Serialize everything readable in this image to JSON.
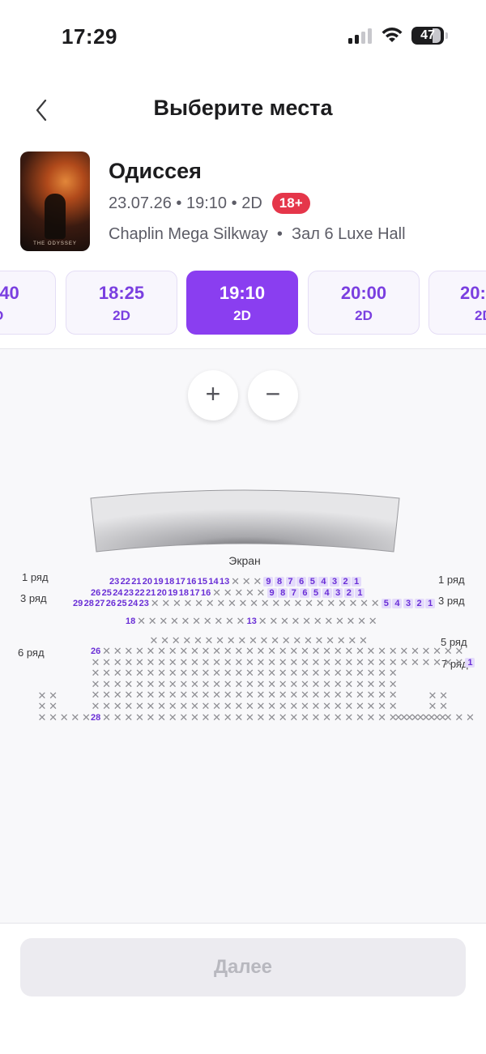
{
  "status_bar": {
    "time": "17:29",
    "battery": "47"
  },
  "header": {
    "title": "Выберите места"
  },
  "movie": {
    "title": "Одиссея",
    "poster_caption": "THE ODYSSEY",
    "date": "23.07.26",
    "time": "19:10",
    "format": "2D",
    "separator": "•",
    "age_rating": "18+",
    "cinema": "Chaplin Mega Silkway",
    "hall": "Зал 6 Luxe Hall"
  },
  "sessions": [
    {
      "time": ":40",
      "format": "D",
      "active": false
    },
    {
      "time": "18:25",
      "format": "2D",
      "active": false
    },
    {
      "time": "19:10",
      "format": "2D",
      "active": true
    },
    {
      "time": "20:00",
      "format": "2D",
      "active": false
    },
    {
      "time": "20:",
      "format": "2D",
      "active": false
    }
  ],
  "zoom": {
    "plus": "+",
    "minus": "−"
  },
  "screen_label": "Экран",
  "row_labels": {
    "row1_left": "1 ряд",
    "row3_left": "3 ряд",
    "row6_left": "6 ряд",
    "row1_right": "1 ряд",
    "row3_right": "3 ряд",
    "row5_right": "5 ряд",
    "row7_right": "7 ряд"
  },
  "seat_rows": [
    {
      "row": "1",
      "left_seats": [
        "23",
        "22",
        "21",
        "20",
        "19",
        "18",
        "17",
        "16",
        "15",
        "14",
        "13"
      ],
      "taken_count": 3,
      "right_seats": [
        "9",
        "8",
        "7",
        "6",
        "5",
        "4",
        "3",
        "2",
        "1"
      ]
    },
    {
      "row": "2",
      "left_seats": [
        "26",
        "25",
        "24",
        "23",
        "22",
        "21",
        "20",
        "19",
        "18",
        "17",
        "16"
      ],
      "taken_count": 5,
      "right_seats": [
        "9",
        "8",
        "7",
        "6",
        "5",
        "4",
        "3",
        "2",
        "1"
      ]
    },
    {
      "row": "3",
      "left_seats": [
        "29",
        "28",
        "27",
        "26",
        "25",
        "24",
        "23"
      ],
      "taken_count": 21,
      "right_seats": [
        "5",
        "4",
        "3",
        "2",
        "1"
      ]
    },
    {
      "row": "4",
      "left_seats": [
        "18"
      ],
      "taken_count": 21,
      "free_middle": "13",
      "right_seats": []
    },
    {
      "row": "5",
      "left_seats": [],
      "taken_count": 20,
      "right_seats": []
    },
    {
      "row": "6",
      "left_seats": [
        "26"
      ],
      "taken_count": 33,
      "right_seats": []
    },
    {
      "row": "7",
      "left_seats": [],
      "taken_count": 34,
      "right_seats": [
        "1"
      ]
    },
    {
      "row": "9",
      "left_seats": [
        "28"
      ],
      "taken_count": 34,
      "right_seats": []
    }
  ],
  "footer": {
    "next_label": "Далее"
  },
  "colors": {
    "accent": "#8a3ef0",
    "age_badge": "#e5364a",
    "free_seat": "#6a2fd6",
    "taken_seat": "#8e8e93"
  }
}
